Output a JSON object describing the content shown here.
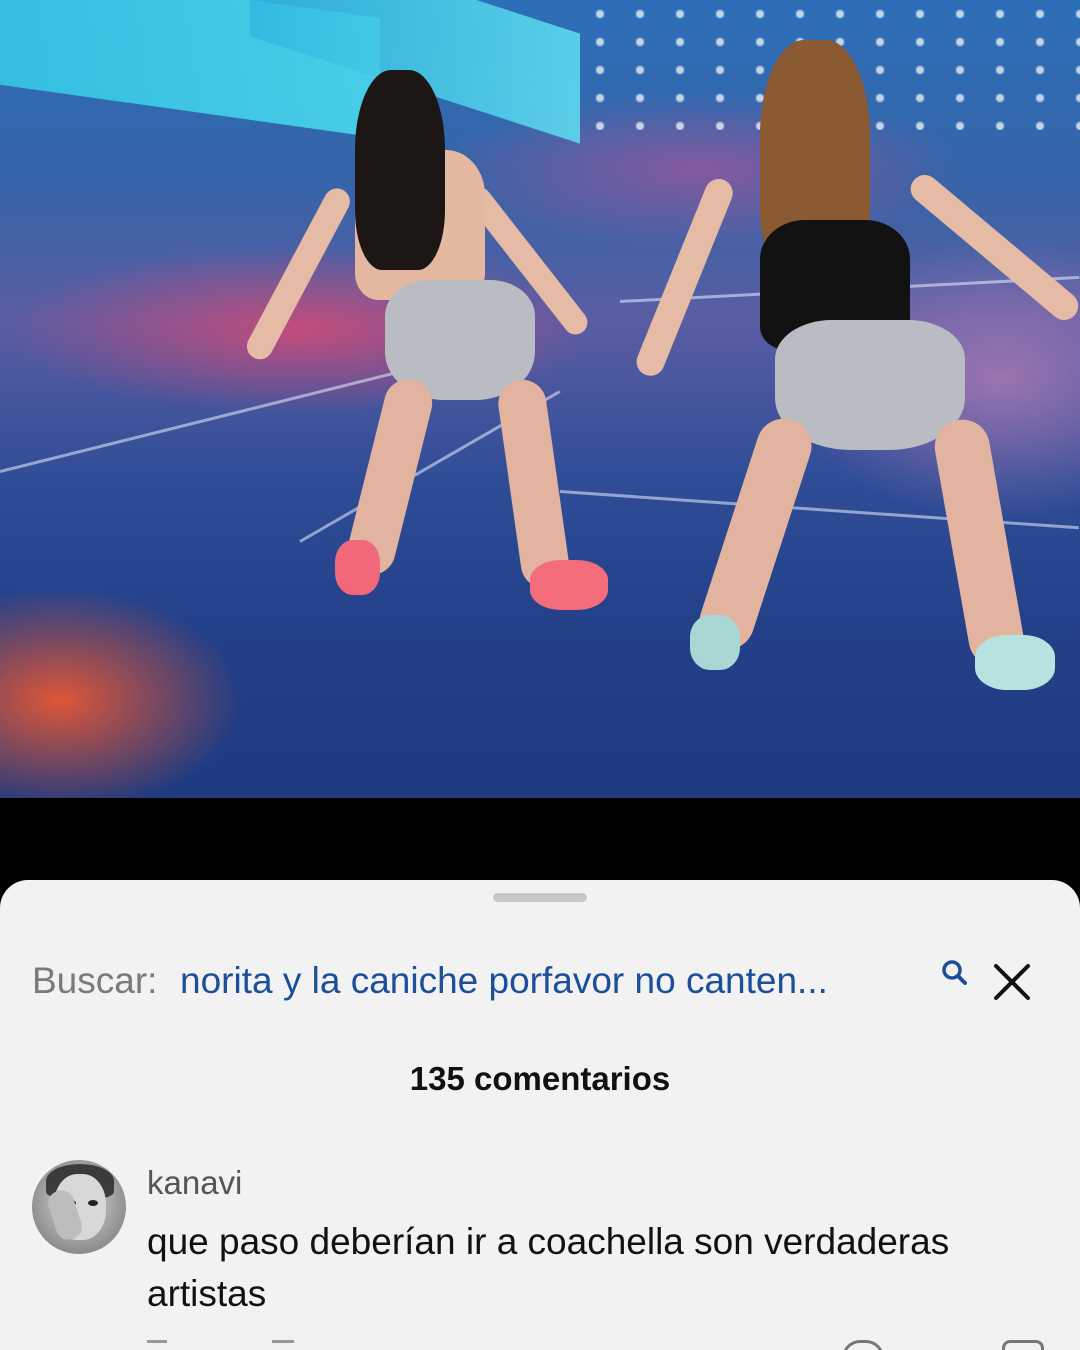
{
  "video": {
    "description_icon": "video-frame"
  },
  "comments_sheet": {
    "search": {
      "prefix": "Buscar:",
      "query": "norita y la caniche porfavor no canten...",
      "icon": "search-icon"
    },
    "close_icon": "close-icon",
    "count_label": "135 comentarios",
    "comments": [
      {
        "username": "kanavi",
        "text": "que paso deberían ir a coachella son verdaderas artistas"
      }
    ]
  },
  "colors": {
    "sheet_bg": "#f2f2f2",
    "search_query": "#1b4f9a",
    "search_prefix": "#7a7a7a"
  }
}
